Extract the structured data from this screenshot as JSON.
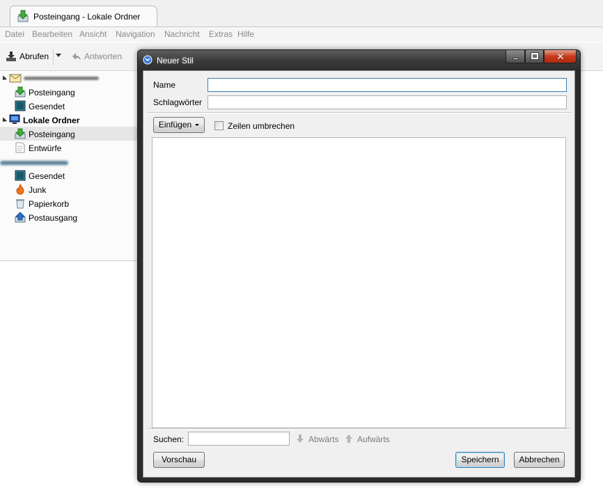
{
  "app": {
    "tab_title": "Posteingang - Lokale Ordner"
  },
  "menubar": {
    "items": [
      "Datei",
      "Bearbeiten",
      "Ansicht",
      "Navigation",
      "Nachricht",
      "Extras",
      "Hilfe"
    ]
  },
  "toolbar": {
    "get_messages_label": "Abrufen",
    "reply_label": "Antworten"
  },
  "folders": {
    "account_posteingang": "Posteingang",
    "account_gesendet": "Gesendet",
    "local_folders": "Lokale Ordner",
    "local_posteingang": "Posteingang",
    "local_entwuerfe": "Entwürfe",
    "local_gesendet": "Gesendet",
    "local_junk": "Junk",
    "local_papierkorb": "Papierkorb",
    "local_postausgang": "Postausgang"
  },
  "dialog": {
    "title": "Neuer Stil",
    "name_label": "Name",
    "name_value": "",
    "keywords_label": "Schlagwörter",
    "keywords_value": "",
    "insert_label": "Einfügen",
    "wrap_label": "Zeilen umbrechen",
    "wrap_checked": false,
    "search_label": "Suchen:",
    "search_value": "",
    "down_label": "Abwärts",
    "up_label": "Aufwärts",
    "preview_label": "Vorschau",
    "save_label": "Speichern",
    "cancel_label": "Abbrechen"
  },
  "colors": {
    "title_bar": "#3a3a3a",
    "close_button": "#c7391c",
    "default_button_border": "#3c7fb1"
  }
}
